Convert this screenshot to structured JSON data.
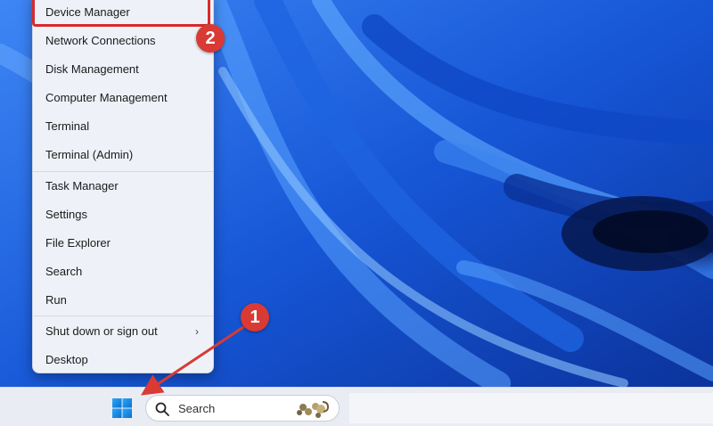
{
  "menu": {
    "items": [
      {
        "label": "Device Manager"
      },
      {
        "label": "Network Connections"
      },
      {
        "label": "Disk Management"
      },
      {
        "label": "Computer Management"
      },
      {
        "label": "Terminal"
      },
      {
        "label": "Terminal (Admin)"
      },
      {
        "label": "Task Manager"
      },
      {
        "label": "Settings"
      },
      {
        "label": "File Explorer"
      },
      {
        "label": "Search"
      },
      {
        "label": "Run"
      },
      {
        "label": "Shut down or sign out"
      },
      {
        "label": "Desktop"
      }
    ],
    "submenu_arrow": "›"
  },
  "annotations": {
    "step1": "1",
    "step2": "2"
  },
  "taskbar": {
    "search_label": "Search",
    "start_icon": "windows-logo-icon"
  },
  "colors": {
    "accent_red": "#d93a34",
    "wallpaper_blue": "#1b5fd8",
    "menu_bg": "#eef2f8"
  }
}
